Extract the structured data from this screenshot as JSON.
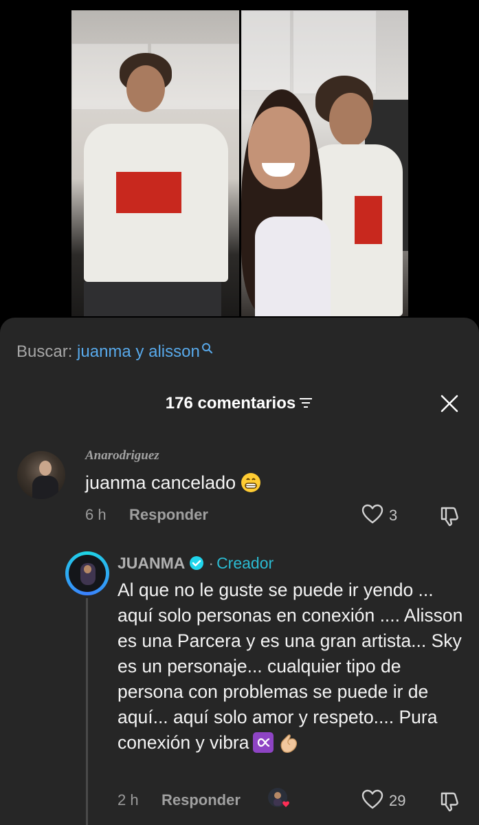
{
  "search": {
    "label": "Buscar:",
    "query": "juanma y alisson"
  },
  "comments_header": {
    "title": "176 comentarios"
  },
  "comments": [
    {
      "username": "Anarodriguez",
      "text": "juanma cancelado",
      "emoji": "grin-emoji",
      "time": "6 h",
      "reply_label": "Responder",
      "likes": "3"
    },
    {
      "username": "JUANMA",
      "badge": "Creador",
      "text": "Al que no le guste se puede ir yendo ... aquí solo personas en conexión .... Alisson es una Parcera y es una gran artista... Sky es un personaje... cualquier tipo de persona con problemas se puede ir de aquí... aquí solo amor y respeto.... Pura conexión y vibra",
      "emojis": [
        "infinity-emoji",
        "pinching-hand-emoji"
      ],
      "time": "2 h",
      "reply_label": "Responder",
      "likes": "29"
    }
  ],
  "colors": {
    "sheet_bg": "#262626",
    "link_blue": "#58a9ea",
    "creator_teal": "#2bbbd2",
    "verified": "#20d5ec"
  },
  "icons": [
    "search-icon",
    "sort-icon",
    "close-icon",
    "heart-icon",
    "dislike-icon",
    "verified-icon"
  ]
}
